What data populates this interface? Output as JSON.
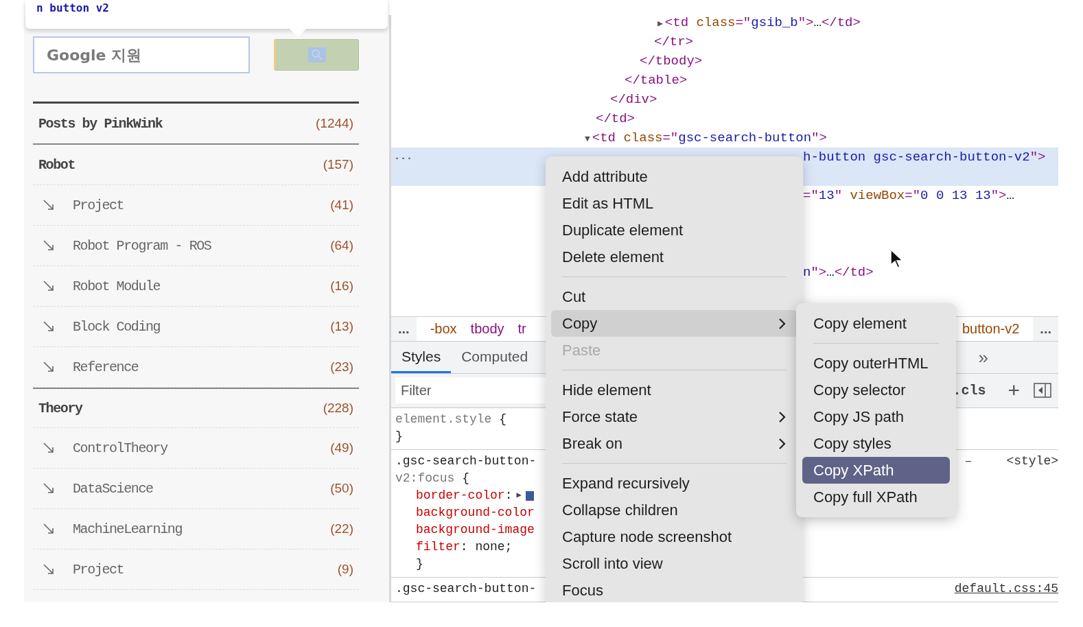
{
  "blog_sidebar": {
    "tooltip": {
      "text": "n button v2"
    },
    "search": {
      "placeholder": "Google 지원"
    },
    "header": {
      "label": "Posts by PinkWink",
      "count": "(1244)"
    },
    "categories": [
      {
        "label": "Robot",
        "count": "(157)",
        "children": [
          {
            "label": "Project",
            "count": "(41)"
          },
          {
            "label": "Robot Program - ROS",
            "count": "(64)"
          },
          {
            "label": "Robot Module",
            "count": "(16)"
          },
          {
            "label": "Block Coding",
            "count": "(13)"
          },
          {
            "label": "Reference",
            "count": "(23)"
          }
        ]
      },
      {
        "label": "Theory",
        "count": "(228)",
        "children": [
          {
            "label": "ControlTheory",
            "count": "(49)"
          },
          {
            "label": "DataScience",
            "count": "(50)"
          },
          {
            "label": "MachineLearning",
            "count": "(22)"
          },
          {
            "label": "Project",
            "count": "(9)"
          }
        ]
      }
    ]
  },
  "devtools": {
    "elements": [
      {
        "selected": false,
        "tokens": [
          {
            "kind": "toggle",
            "text": "▶"
          },
          {
            "kind": "tag",
            "text": "<td "
          },
          {
            "kind": "attr",
            "text": "class"
          },
          {
            "kind": "tag",
            "text": "=\""
          },
          {
            "kind": "value",
            "text": "gsib_b"
          },
          {
            "kind": "tag",
            "text": "\">"
          },
          {
            "kind": "plain",
            "text": "…"
          },
          {
            "kind": "tag",
            "text": "</td>"
          }
        ]
      },
      {
        "selected": false,
        "tokens": [
          {
            "kind": "tag",
            "text": "</tr>"
          }
        ]
      },
      {
        "selected": false,
        "tokens": [
          {
            "kind": "tag",
            "text": "</tbody>"
          }
        ]
      },
      {
        "selected": false,
        "tokens": [
          {
            "kind": "tag",
            "text": "</table>"
          }
        ]
      },
      {
        "selected": false,
        "tokens": [
          {
            "kind": "tag",
            "text": "</div>"
          }
        ]
      },
      {
        "selected": false,
        "tokens": [
          {
            "kind": "tag",
            "text": "</td>"
          }
        ]
      },
      {
        "selected": false,
        "tokens": [
          {
            "kind": "toggle",
            "text": "▼"
          },
          {
            "kind": "tag",
            "text": "<td "
          },
          {
            "kind": "attr",
            "text": "class"
          },
          {
            "kind": "tag",
            "text": "=\""
          },
          {
            "kind": "value",
            "text": "gsc-search-button"
          },
          {
            "kind": "tag",
            "text": "\">"
          }
        ]
      },
      {
        "selected": true,
        "more": "...",
        "tokens": [
          {
            "kind": "value",
            "text": "h-button gsc-search-button-v2"
          },
          {
            "kind": "tag",
            "text": "\">"
          }
        ]
      },
      {
        "selected": false,
        "tokens": [
          {
            "kind": "tag",
            "text": "=\""
          },
          {
            "kind": "value",
            "text": "13"
          },
          {
            "kind": "tag",
            "text": "\" "
          },
          {
            "kind": "attr",
            "text": "viewBox"
          },
          {
            "kind": "tag",
            "text": "=\""
          },
          {
            "kind": "value",
            "text": "0 0 13 13"
          },
          {
            "kind": "tag",
            "text": "\">"
          },
          {
            "kind": "plain",
            "text": "…"
          }
        ]
      },
      {
        "selected": false,
        "tokens": [
          {
            "kind": "value",
            "text": "n"
          },
          {
            "kind": "tag",
            "text": "\">"
          },
          {
            "kind": "plain",
            "text": "…"
          },
          {
            "kind": "tag",
            "text": "</td>"
          }
        ]
      }
    ],
    "breadcrumbs": [
      {
        "kind": "more",
        "text": "..."
      },
      {
        "kind": "class",
        "text": "-box"
      },
      {
        "kind": "tag",
        "text": "tbody"
      },
      {
        "kind": "tag",
        "text": "tr"
      },
      {
        "kind": "class",
        "text": "button-v2"
      },
      {
        "kind": "more",
        "text": "..."
      }
    ],
    "tabs": [
      {
        "label": "Styles",
        "selected": true
      },
      {
        "label": "Computed",
        "selected": false
      }
    ],
    "tabs_overflow": "»",
    "filter": {
      "placeholder": "Filter",
      "cls_label": ".cls",
      "add_label": "+"
    },
    "rules": [
      {
        "lines": [
          [
            {
              "kind": "selector-dim",
              "text": "element.style "
            },
            {
              "kind": "punct",
              "text": "{"
            }
          ],
          [
            {
              "kind": "punct",
              "text": "}"
            }
          ]
        ]
      },
      {
        "origin": "<style>",
        "origin_dash": "–",
        "lines": [
          [
            {
              "kind": "selector",
              "text": ".gsc-search-button-"
            }
          ],
          [
            {
              "kind": "selector-dim",
              "text": "v2:focus "
            },
            {
              "kind": "punct",
              "text": "{"
            }
          ],
          [
            {
              "kind": "prop",
              "text": "border-color"
            },
            {
              "kind": "punct",
              "text": ":"
            },
            {
              "kind": "toggle",
              "text": "▶"
            },
            {
              "kind": "swatch",
              "color": "#3b5998"
            }
          ],
          [
            {
              "kind": "prop",
              "text": "background-color"
            }
          ],
          [
            {
              "kind": "prop",
              "text": "background-image"
            }
          ],
          [
            {
              "kind": "prop",
              "text": "filter"
            },
            {
              "kind": "punct",
              "text": ": none;"
            }
          ],
          [
            {
              "kind": "punct",
              "text": "}"
            }
          ]
        ]
      },
      {
        "origin": "default.css:45",
        "lines": [
          [
            {
              "kind": "selector",
              "text": ".gsc-search-button-"
            }
          ]
        ]
      }
    ],
    "context_menu": [
      {
        "kind": "item",
        "label": "Add attribute",
        "selected": false,
        "disabled": false,
        "submenu": false
      },
      {
        "kind": "item",
        "label": "Edit as HTML",
        "selected": false,
        "disabled": false,
        "submenu": false
      },
      {
        "kind": "item",
        "label": "Duplicate element",
        "selected": false,
        "disabled": false,
        "submenu": false
      },
      {
        "kind": "item",
        "label": "Delete element",
        "selected": false,
        "disabled": false,
        "submenu": false
      },
      {
        "kind": "separator"
      },
      {
        "kind": "item",
        "label": "Cut",
        "selected": false,
        "disabled": false,
        "submenu": false
      },
      {
        "kind": "item",
        "label": "Copy",
        "selected": true,
        "disabled": false,
        "submenu": true
      },
      {
        "kind": "item",
        "label": "Paste",
        "selected": false,
        "disabled": true,
        "submenu": false
      },
      {
        "kind": "separator"
      },
      {
        "kind": "item",
        "label": "Hide element",
        "selected": false,
        "disabled": false,
        "submenu": false
      },
      {
        "kind": "item",
        "label": "Force state",
        "selected": false,
        "disabled": false,
        "submenu": true
      },
      {
        "kind": "item",
        "label": "Break on",
        "selected": false,
        "disabled": false,
        "submenu": true
      },
      {
        "kind": "separator"
      },
      {
        "kind": "item",
        "label": "Expand recursively",
        "selected": false,
        "disabled": false,
        "submenu": false
      },
      {
        "kind": "item",
        "label": "Collapse children",
        "selected": false,
        "disabled": false,
        "submenu": false
      },
      {
        "kind": "item",
        "label": "Capture node screenshot",
        "selected": false,
        "disabled": false,
        "submenu": false
      },
      {
        "kind": "item",
        "label": "Scroll into view",
        "selected": false,
        "disabled": false,
        "submenu": false
      },
      {
        "kind": "item",
        "label": "Focus",
        "selected": false,
        "disabled": false,
        "submenu": false
      }
    ],
    "copy_submenu": [
      {
        "kind": "item",
        "label": "Copy element",
        "selected": false
      },
      {
        "kind": "separator"
      },
      {
        "kind": "item",
        "label": "Copy outerHTML",
        "selected": false
      },
      {
        "kind": "item",
        "label": "Copy selector",
        "selected": false
      },
      {
        "kind": "item",
        "label": "Copy JS path",
        "selected": false
      },
      {
        "kind": "item",
        "label": "Copy styles",
        "selected": false
      },
      {
        "kind": "item",
        "label": "Copy XPath",
        "selected": true
      },
      {
        "kind": "item",
        "label": "Copy full XPath",
        "selected": false
      }
    ]
  }
}
